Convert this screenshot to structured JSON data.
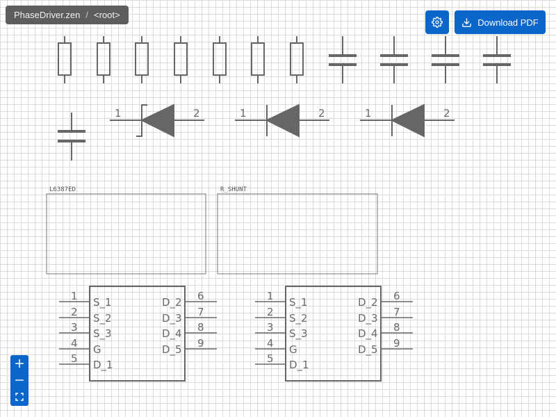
{
  "breadcrumb": {
    "file": "PhaseDriver.zen",
    "separator": "/",
    "current": "<root>"
  },
  "toolbar": {
    "settings_icon": "gear-icon",
    "download_label": "Download PDF",
    "download_icon": "download-icon"
  },
  "zoom": {
    "zoom_in_icon": "plus-icon",
    "zoom_out_icon": "minus-icon",
    "fit_icon": "fit-screen-icon"
  },
  "colors": {
    "accent": "#0b66cc",
    "breadcrumb_bg": "#5d5d5d",
    "symbol_stroke": "#666666",
    "grid": "#dcdcdc"
  },
  "schematic": {
    "diodes": [
      {
        "type": "schottky",
        "pin1": "1",
        "pin2": "2"
      },
      {
        "type": "standard",
        "pin1": "1",
        "pin2": "2"
      },
      {
        "type": "standard",
        "pin1": "1",
        "pin2": "2"
      }
    ],
    "blocks": [
      {
        "title": "L6387ED"
      },
      {
        "title": "R_SHUNT"
      }
    ],
    "mosfets": [
      {
        "left_pins": [
          {
            "num": "1",
            "name": "S_1"
          },
          {
            "num": "2",
            "name": "S_2"
          },
          {
            "num": "3",
            "name": "S_3"
          },
          {
            "num": "4",
            "name": "G"
          },
          {
            "num": "5",
            "name": "D_1"
          }
        ],
        "right_pins": [
          {
            "num": "6",
            "name": "D_2"
          },
          {
            "num": "7",
            "name": "D_3"
          },
          {
            "num": "8",
            "name": "D_4"
          },
          {
            "num": "9",
            "name": "D_5"
          }
        ]
      },
      {
        "left_pins": [
          {
            "num": "1",
            "name": "S_1"
          },
          {
            "num": "2",
            "name": "S_2"
          },
          {
            "num": "3",
            "name": "S_3"
          },
          {
            "num": "4",
            "name": "G"
          },
          {
            "num": "5",
            "name": "D_1"
          }
        ],
        "right_pins": [
          {
            "num": "6",
            "name": "D_2"
          },
          {
            "num": "7",
            "name": "D_3"
          },
          {
            "num": "8",
            "name": "D_4"
          },
          {
            "num": "9",
            "name": "D_5"
          }
        ]
      }
    ]
  }
}
